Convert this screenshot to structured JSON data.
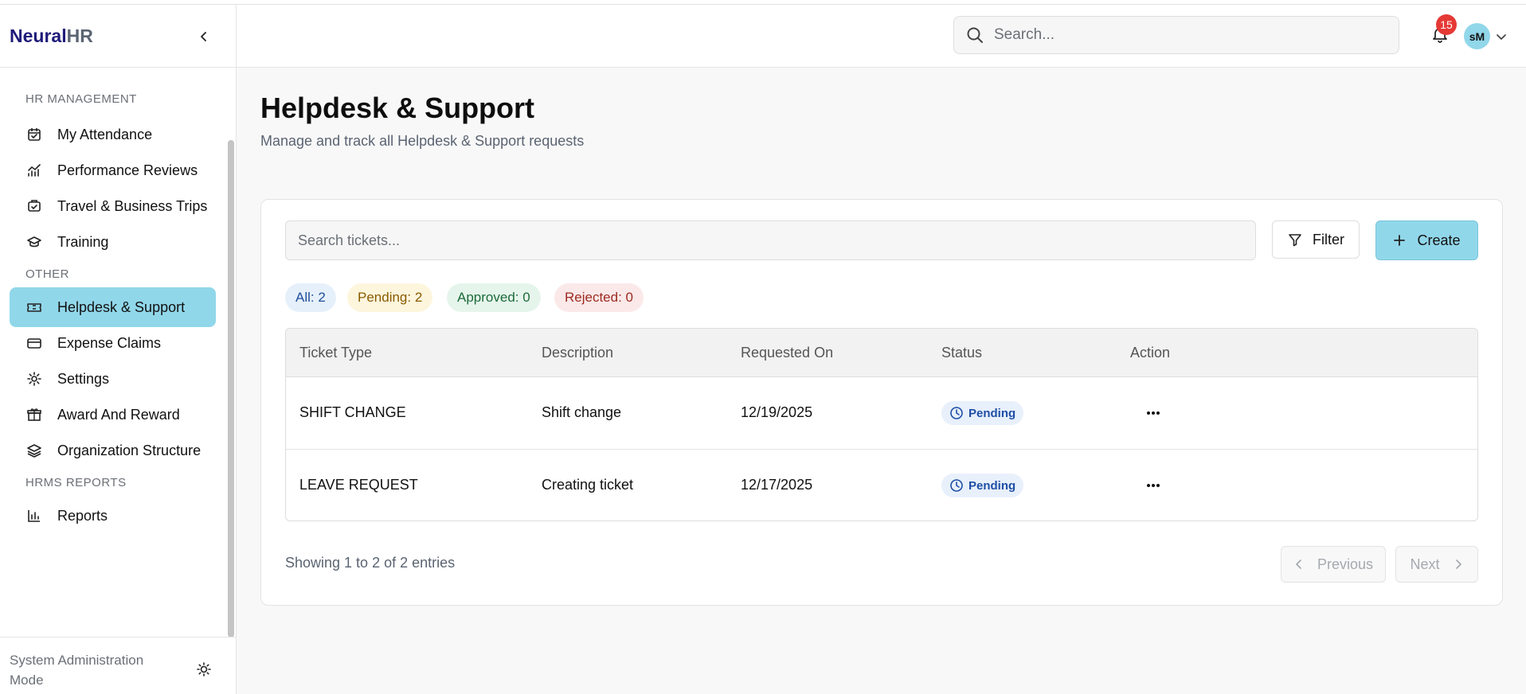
{
  "brand": {
    "name_primary": "Neural",
    "name_secondary": "HR"
  },
  "sidebar": {
    "sections": [
      {
        "title": "HR MANAGEMENT"
      },
      {
        "title": "OTHER"
      },
      {
        "title": "HRMS REPORTS"
      }
    ],
    "items": [
      {
        "label": "My Attendance",
        "icon": "calendar-check-icon"
      },
      {
        "label": "Performance Reviews",
        "icon": "chart-line-icon"
      },
      {
        "label": "Travel & Business Trips",
        "icon": "plane-ticket-icon"
      },
      {
        "label": "Training",
        "icon": "graduation-cap-icon"
      },
      {
        "label": "Helpdesk & Support",
        "icon": "ticket-icon",
        "active": true
      },
      {
        "label": "Expense Claims",
        "icon": "credit-card-icon"
      },
      {
        "label": "Settings",
        "icon": "gear-icon"
      },
      {
        "label": "Award And Reward",
        "icon": "gift-icon"
      },
      {
        "label": "Organization Structure",
        "icon": "layers-icon"
      },
      {
        "label": "Reports",
        "icon": "bar-chart-icon"
      }
    ],
    "footer": {
      "label": "System Administration Mode",
      "icon": "sun-icon"
    }
  },
  "header": {
    "search_placeholder": "Search...",
    "notifications_count": "15",
    "avatar_initials": "sM"
  },
  "page": {
    "title": "Helpdesk & Support",
    "subtitle": "Manage and track all Helpdesk & Support requests"
  },
  "toolbar": {
    "search_placeholder": "Search tickets...",
    "filter_label": "Filter",
    "create_label": "Create"
  },
  "chips": {
    "all": "All: 2",
    "pending": "Pending: 2",
    "approved": "Approved: 0",
    "rejected": "Rejected: 0"
  },
  "table": {
    "columns": [
      "Ticket Type",
      "Description",
      "Requested On",
      "Status",
      "Action"
    ],
    "rows": [
      {
        "type": "SHIFT CHANGE",
        "description": "Shift change",
        "requested_on": "12/19/2025",
        "status": "Pending"
      },
      {
        "type": "LEAVE REQUEST",
        "description": "Creating ticket",
        "requested_on": "12/17/2025",
        "status": "Pending"
      }
    ]
  },
  "pagination": {
    "summary": "Showing 1 to 2 of 2 entries",
    "previous_label": "Previous",
    "next_label": "Next"
  },
  "colors": {
    "accent": "#91d7ea",
    "brand": "#1f1b7a",
    "badge": "#e53935"
  }
}
